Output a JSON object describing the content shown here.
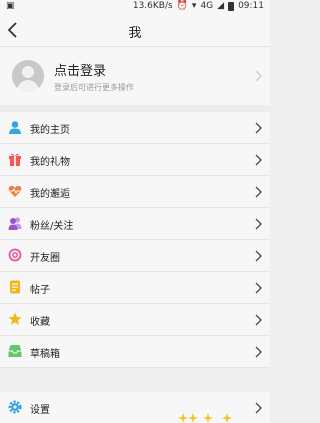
{
  "status_bar": {
    "speed": "13.6KB/s",
    "network": "4G",
    "time": "09:11"
  },
  "nav": {
    "title": "我"
  },
  "profile": {
    "login": "点击登录",
    "hint": "登录后可进行更多操作"
  },
  "menu": [
    {
      "label": "我的主页",
      "icon": "person-icon",
      "color": "#34a3e6"
    },
    {
      "label": "我的礼物",
      "icon": "gift-icon",
      "color": "#f25a55"
    },
    {
      "label": "我的邂逅",
      "icon": "heart-pulse-icon",
      "color": "#f47b3c"
    },
    {
      "label": "粉丝/关注",
      "icon": "people-icon",
      "color": "#9b55c9"
    },
    {
      "label": "开友圈",
      "icon": "target-icon",
      "color": "#ec5fa4"
    },
    {
      "label": "帖子",
      "icon": "document-icon",
      "color": "#f3b51b"
    },
    {
      "label": "收藏",
      "icon": "star-icon",
      "color": "#f3b51b"
    },
    {
      "label": "草稿箱",
      "icon": "inbox-tray-icon",
      "color": "#62c86e"
    }
  ],
  "settings": {
    "label": "设置",
    "icon": "gear-icon",
    "color": "#36a4e0"
  }
}
